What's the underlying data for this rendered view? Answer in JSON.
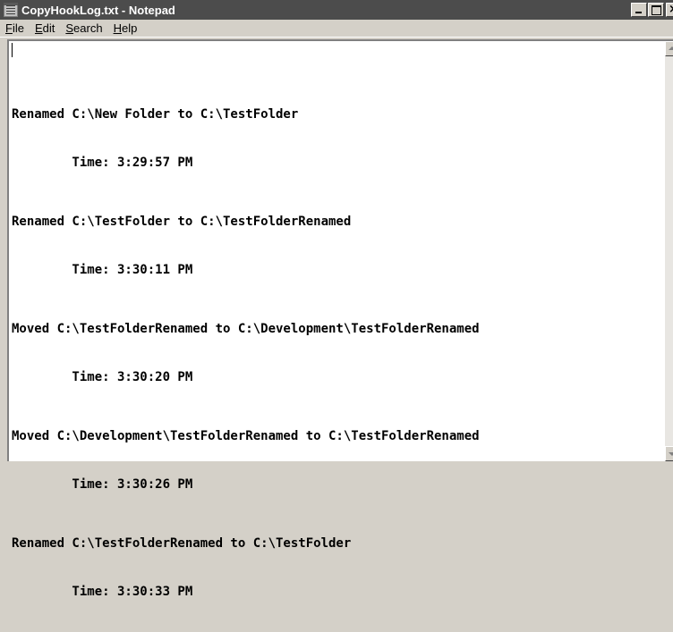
{
  "window": {
    "title": "CopyHookLog.txt - Notepad",
    "icon": "notepad-icon",
    "controls": [
      "minimize-icon",
      "maximize-icon",
      "close-icon"
    ]
  },
  "menu": [
    {
      "label": "File",
      "accel": "F",
      "rest": "ile"
    },
    {
      "label": "Edit",
      "accel": "E",
      "rest": "dit"
    },
    {
      "label": "Search",
      "accel": "S",
      "rest": "earch"
    },
    {
      "label": "Help",
      "accel": "H",
      "rest": "elp"
    }
  ],
  "log": [
    {
      "action": "Renamed C:\\New Folder to C:\\TestFolder",
      "time": "        Time: 3:29:57 PM"
    },
    {
      "action": "Renamed C:\\TestFolder to C:\\TestFolderRenamed",
      "time": "        Time: 3:30:11 PM"
    },
    {
      "action": "Moved C:\\TestFolderRenamed to C:\\Development\\TestFolderRenamed",
      "time": "        Time: 3:30:20 PM"
    },
    {
      "action": "Moved C:\\Development\\TestFolderRenamed to C:\\TestFolderRenamed",
      "time": "        Time: 3:30:26 PM"
    },
    {
      "action": "Renamed C:\\TestFolderRenamed to C:\\TestFolder",
      "time": "        Time: 3:30:33 PM"
    }
  ],
  "colors": {
    "titlebar": "#4c4c4c",
    "face": "#d4d0c8",
    "text_background": "#ffffff"
  }
}
